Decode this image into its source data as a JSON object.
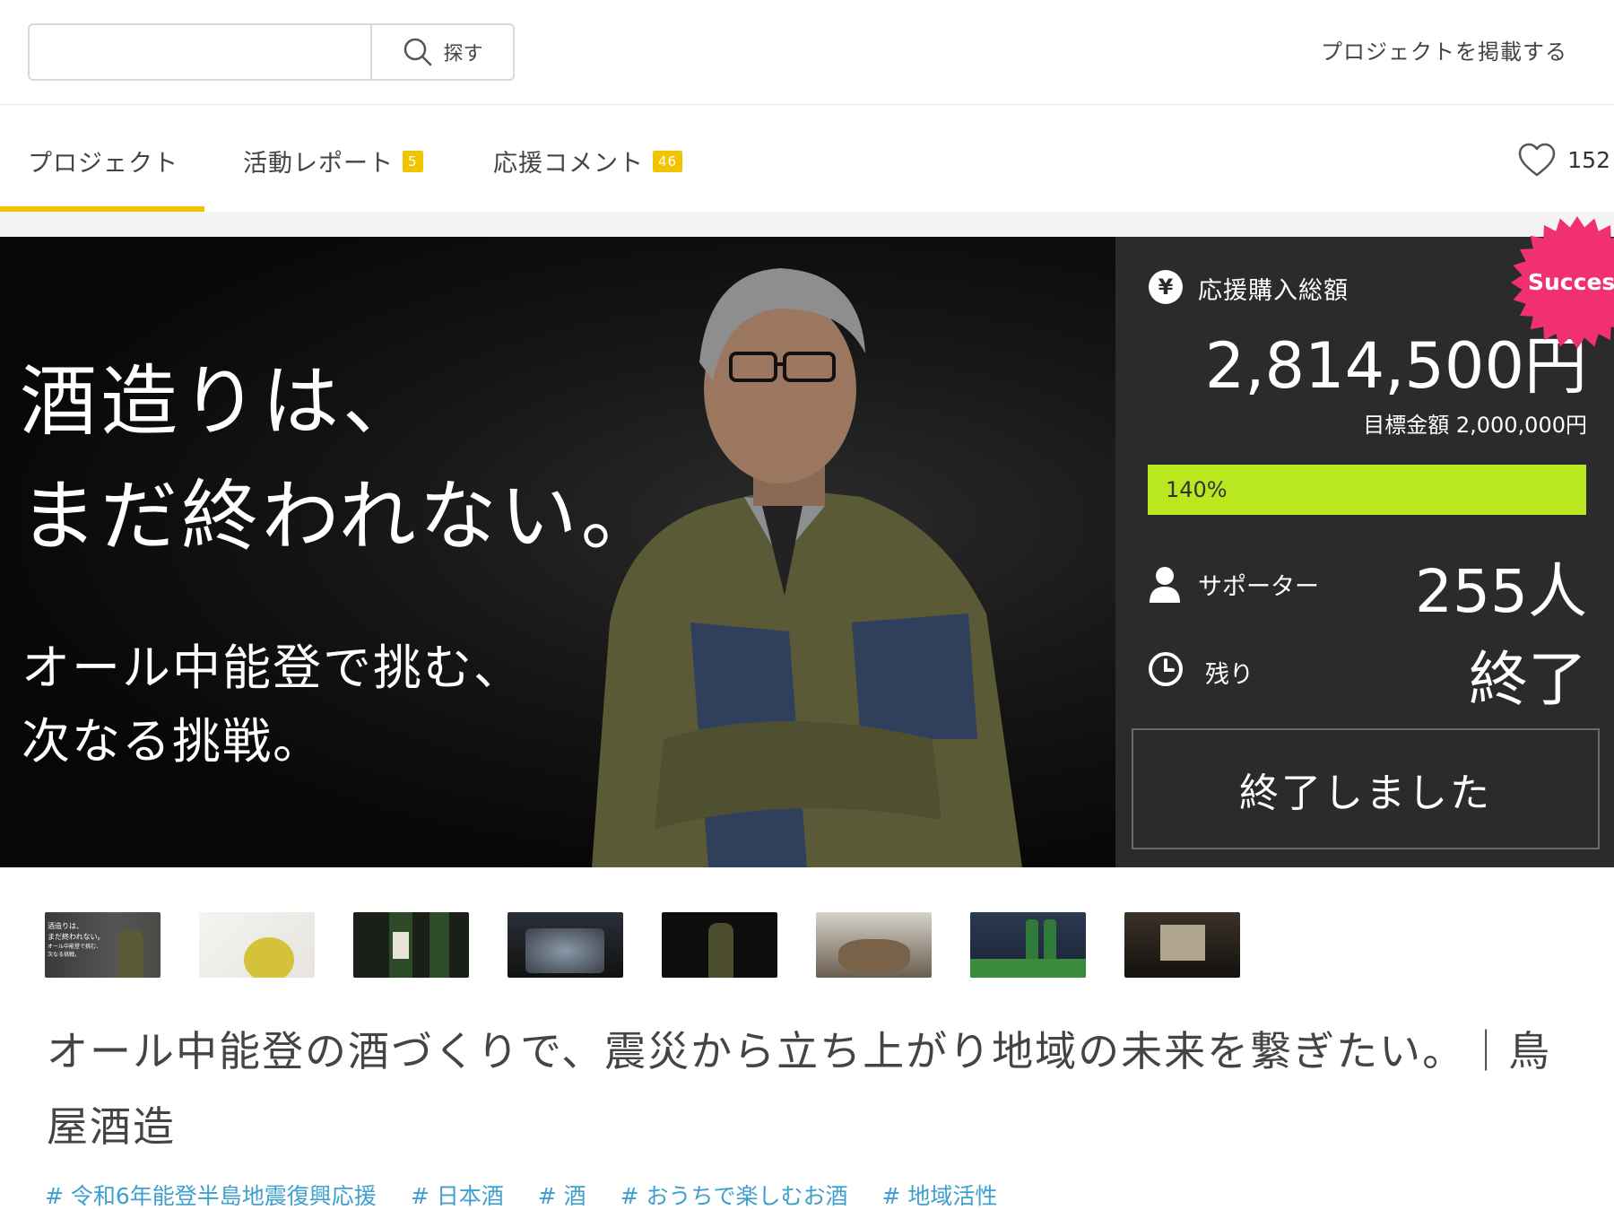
{
  "header": {
    "search_placeholder": "",
    "search_label": "探す",
    "post_project_label": "プロジェクトを掲載する"
  },
  "tabs": [
    {
      "label": "プロジェクト",
      "badge": ""
    },
    {
      "label": "活動レポート",
      "badge": "5"
    },
    {
      "label": "応援コメント",
      "badge": "46"
    }
  ],
  "favorites": {
    "count": "152",
    "icon": "heart-icon"
  },
  "hero": {
    "line1": "酒造りは、",
    "line2": "まだ終われない。",
    "line3": "オール中能登で挑む、",
    "line4": "次なる挑戦。"
  },
  "stats": {
    "total_label": "応援購入総額",
    "total_amount": "2,814,500円",
    "goal_text": "目標金額 2,000,000円",
    "progress_text": "140%",
    "progress_fraction": 1.0,
    "supporters_label": "サポーター",
    "supporters_count": "255人",
    "remaining_label": "残り",
    "remaining_value": "終了",
    "ended_button": "終了しました",
    "success_badge": "Success",
    "accent_color": "#b9e81e",
    "badge_color": "#f0306f"
  },
  "thumbnails": [
    {
      "caption1": "酒造りは、",
      "caption2": "まだ終われない。",
      "caption3": "オール中能登で挑む、",
      "caption4": "次なる挑戦。"
    },
    {},
    {},
    {},
    {},
    {},
    {},
    {}
  ],
  "title": "オール中能登の酒づくりで、震災から立ち上がり地域の未来を繋ぎたい。｜鳥屋酒造",
  "tags": [
    "# 令和6年能登半島地震復興応援",
    "# 日本酒",
    "# 酒",
    "# おうちで楽しむお酒",
    "# 地域活性"
  ]
}
